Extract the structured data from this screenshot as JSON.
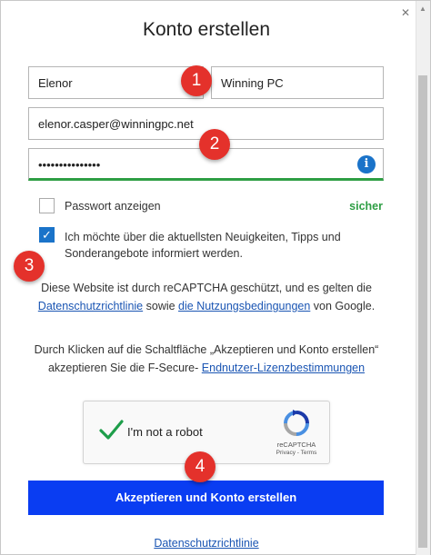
{
  "window": {
    "title": "Konto erstellen"
  },
  "form": {
    "first_name": "Elenor",
    "last_name": "Winning PC",
    "email": "elenor.casper@winningpc.net",
    "password_masked": "•••••••••••••••",
    "password_info_glyph": "i",
    "show_password_label": "Passwort anzeigen",
    "password_strength": "sicher",
    "newsletter_label": "Ich möchte über die aktuellsten Neuigkeiten, Tipps und Sonderangebote informiert werden.",
    "newsletter_checked": true
  },
  "recaptcha_notice": {
    "part1": "Diese Website ist durch reCAPTCHA geschützt, und es gelten die ",
    "privacy_link": "Datenschutzrichtlinie",
    "part2": " sowie ",
    "terms_link": "die Nutzungsbedingungen",
    "part3": " von Google."
  },
  "terms_notice": {
    "part1": "Durch Klicken auf die Schaltfläche „Akzeptieren und Konto erstellen“ akzeptieren Sie die F-Secure- ",
    "eula_link": "Endnutzer-Lizenzbestimmungen"
  },
  "captcha": {
    "label": "I'm not a robot",
    "brand": "reCAPTCHA",
    "links": "Privacy - Terms"
  },
  "submit_label": "Akzeptieren und Konto erstellen",
  "footer_link": "Datenschutzrichtlinie",
  "markers": [
    "1",
    "2",
    "3",
    "4"
  ],
  "colors": {
    "submit_bg": "#0a3df2",
    "strength_green": "#2e9e44",
    "link_blue": "#1a55b3",
    "marker_red": "#e4312b"
  }
}
